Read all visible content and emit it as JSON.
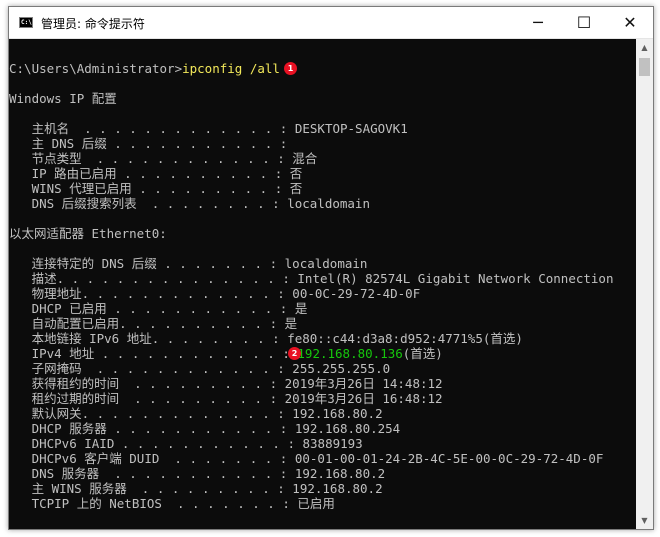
{
  "window": {
    "title": "管理员: 命令提示符",
    "icon_text": "C:\\",
    "controls": {
      "minimize": "─",
      "maximize": "☐",
      "close": "✕"
    }
  },
  "badges": [
    "1",
    "2"
  ],
  "console": {
    "command_prompt": "C:\\Users\\Administrator>",
    "command": "ipconfig /all",
    "lines": [
      "Windows IP 配置",
      "   主机名  . . . . . . . . . . . . . : DESKTOP-SAGOVK1",
      "   主 DNS 后缀 . . . . . . . . . . . :",
      "   节点类型  . . . . . . . . . . . . : 混合",
      "   IP 路由已启用 . . . . . . . . . . : 否",
      "   WINS 代理已启用 . . . . . . . . . : 否",
      "   DNS 后缀搜索列表  . . . . . . . . : localdomain",
      "以太网适配器 Ethernet0:",
      "   连接特定的 DNS 后缀 . . . . . . . : localdomain",
      "   描述. . . . . . . . . . . . . . . : Intel(R) 82574L Gigabit Network Connection",
      "   物理地址. . . . . . . . . . . . . : 00-0C-29-72-4D-0F",
      "   DHCP 已启用 . . . . . . . . . . . : 是",
      "   自动配置已启用. . . . . . . . . . : 是",
      "   本地链接 IPv6 地址. . . . . . . . : fe80::c44:d3a8:d952:4771%5(首选)",
      "   IPv4 地址 . . . . . . . . . . . . : ",
      "   子网掩码  . . . . . . . . . . . . : 255.255.255.0",
      "   获得租约的时间  . . . . . . . . . : 2019年3月26日 14:48:12",
      "   租约过期的时间  . . . . . . . . . : 2019年3月26日 16:48:12",
      "   默认网关. . . . . . . . . . . . . : 192.168.80.2",
      "   DHCP 服务器 . . . . . . . . . . . : 192.168.80.254",
      "   DHCPv6 IAID . . . . . . . . . . . : 83889193",
      "   DHCPv6 客户端 DUID  . . . . . . . : 00-01-00-01-24-2B-4C-5E-00-0C-29-72-4D-0F",
      "   DNS 服务器  . . . . . . . . . . . : 192.168.80.2",
      "   主 WINS 服务器  . . . . . . . . . : 192.168.80.2",
      "   TCPIP 上的 NetBIOS  . . . . . . . : 已启用"
    ],
    "ipv4_value": "192.168.80.136",
    "ipv4_suffix": "(首选)"
  },
  "colors": {
    "console_bg": "#0c0c0c",
    "console_text": "#c0c0c0",
    "command_highlight": "#f2e85a",
    "ipv4_highlight": "#16c60c",
    "badge": "#e81123"
  }
}
